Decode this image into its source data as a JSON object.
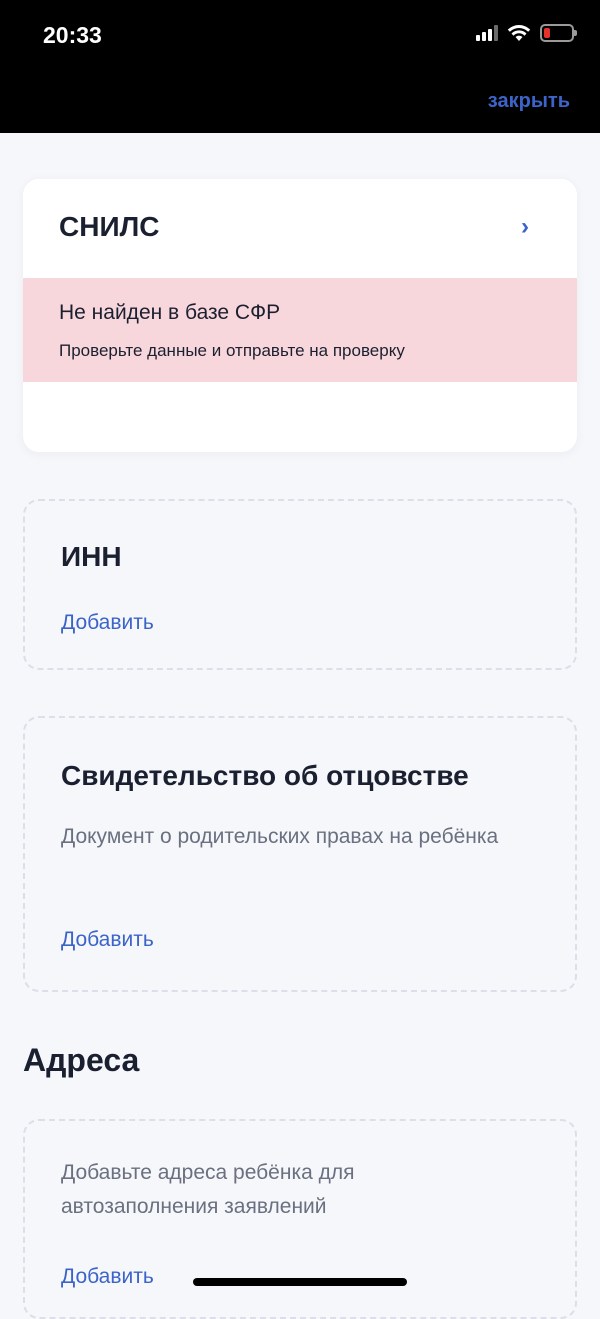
{
  "status_bar": {
    "time": "20:33",
    "icons": [
      "signal-icon",
      "wifi-icon",
      "battery-icon"
    ]
  },
  "header": {
    "close_label": "закрыть"
  },
  "snils_card": {
    "title": "СНИЛС",
    "error_title": "Не найден в базе СФР",
    "error_subtitle": "Проверьте данные и отправьте на проверку"
  },
  "inn_card": {
    "title": "ИНН",
    "add_label": "Добавить"
  },
  "paternity_card": {
    "title": "Свидетельство об отцовстве",
    "description": "Документ о родительских правах на ребёнка",
    "add_label": "Добавить"
  },
  "addresses_section": {
    "title": "Адреса",
    "description": "Добавьте адреса ребёнка для автозаполнения заявлений",
    "add_label": "Добавить"
  },
  "colors": {
    "accent": "#3c64c8",
    "error_bg": "#f8d7dc",
    "page_bg": "#f6f7fb"
  }
}
